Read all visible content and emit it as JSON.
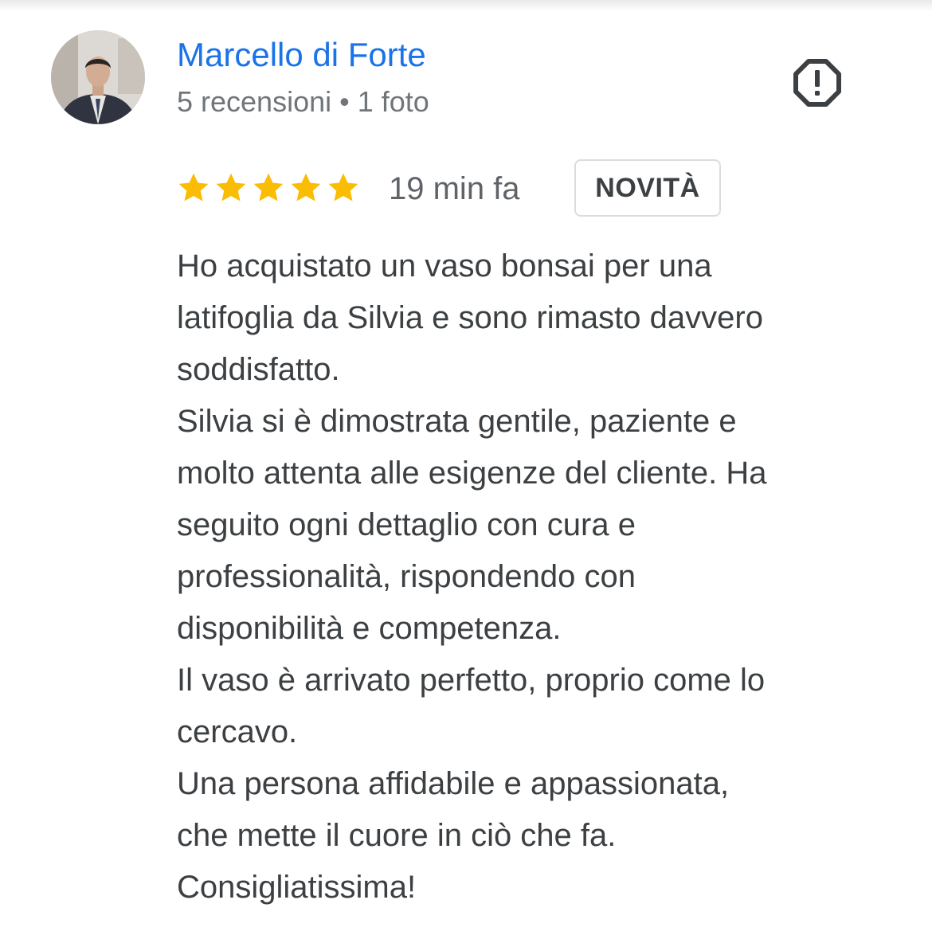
{
  "reviewer": {
    "name": "Marcello di Forte",
    "stats": "5 recensioni • 1 foto"
  },
  "review": {
    "rating": 5,
    "rating_max": 5,
    "time": "19 min fa",
    "badge": "NOVITÀ",
    "lines": [
      "Ho acquistato un vaso bonsai per una",
      "latifoglia da Silvia e sono rimasto davvero",
      "soddisfatto.",
      "Silvia si è dimostrata gentile, paziente e",
      "molto attenta alle esigenze del cliente. Ha",
      "seguito ogni dettaglio con cura e",
      "professionalità, rispondendo con",
      "disponibilità e competenza.",
      "Il vaso è arrivato perfetto, proprio come lo",
      "cercavo.",
      "Una persona affidabile e appassionata,",
      "che mette il cuore in ciò che fa.",
      "Consigliatissima!"
    ]
  },
  "icons": {
    "report": "report-flag-icon",
    "star": "star-icon"
  },
  "colors": {
    "name_link": "#1a73e8",
    "star": "#fbbc04",
    "secondary_text": "#70757a",
    "body_text": "#3c4043",
    "badge_border": "#dadce0"
  }
}
